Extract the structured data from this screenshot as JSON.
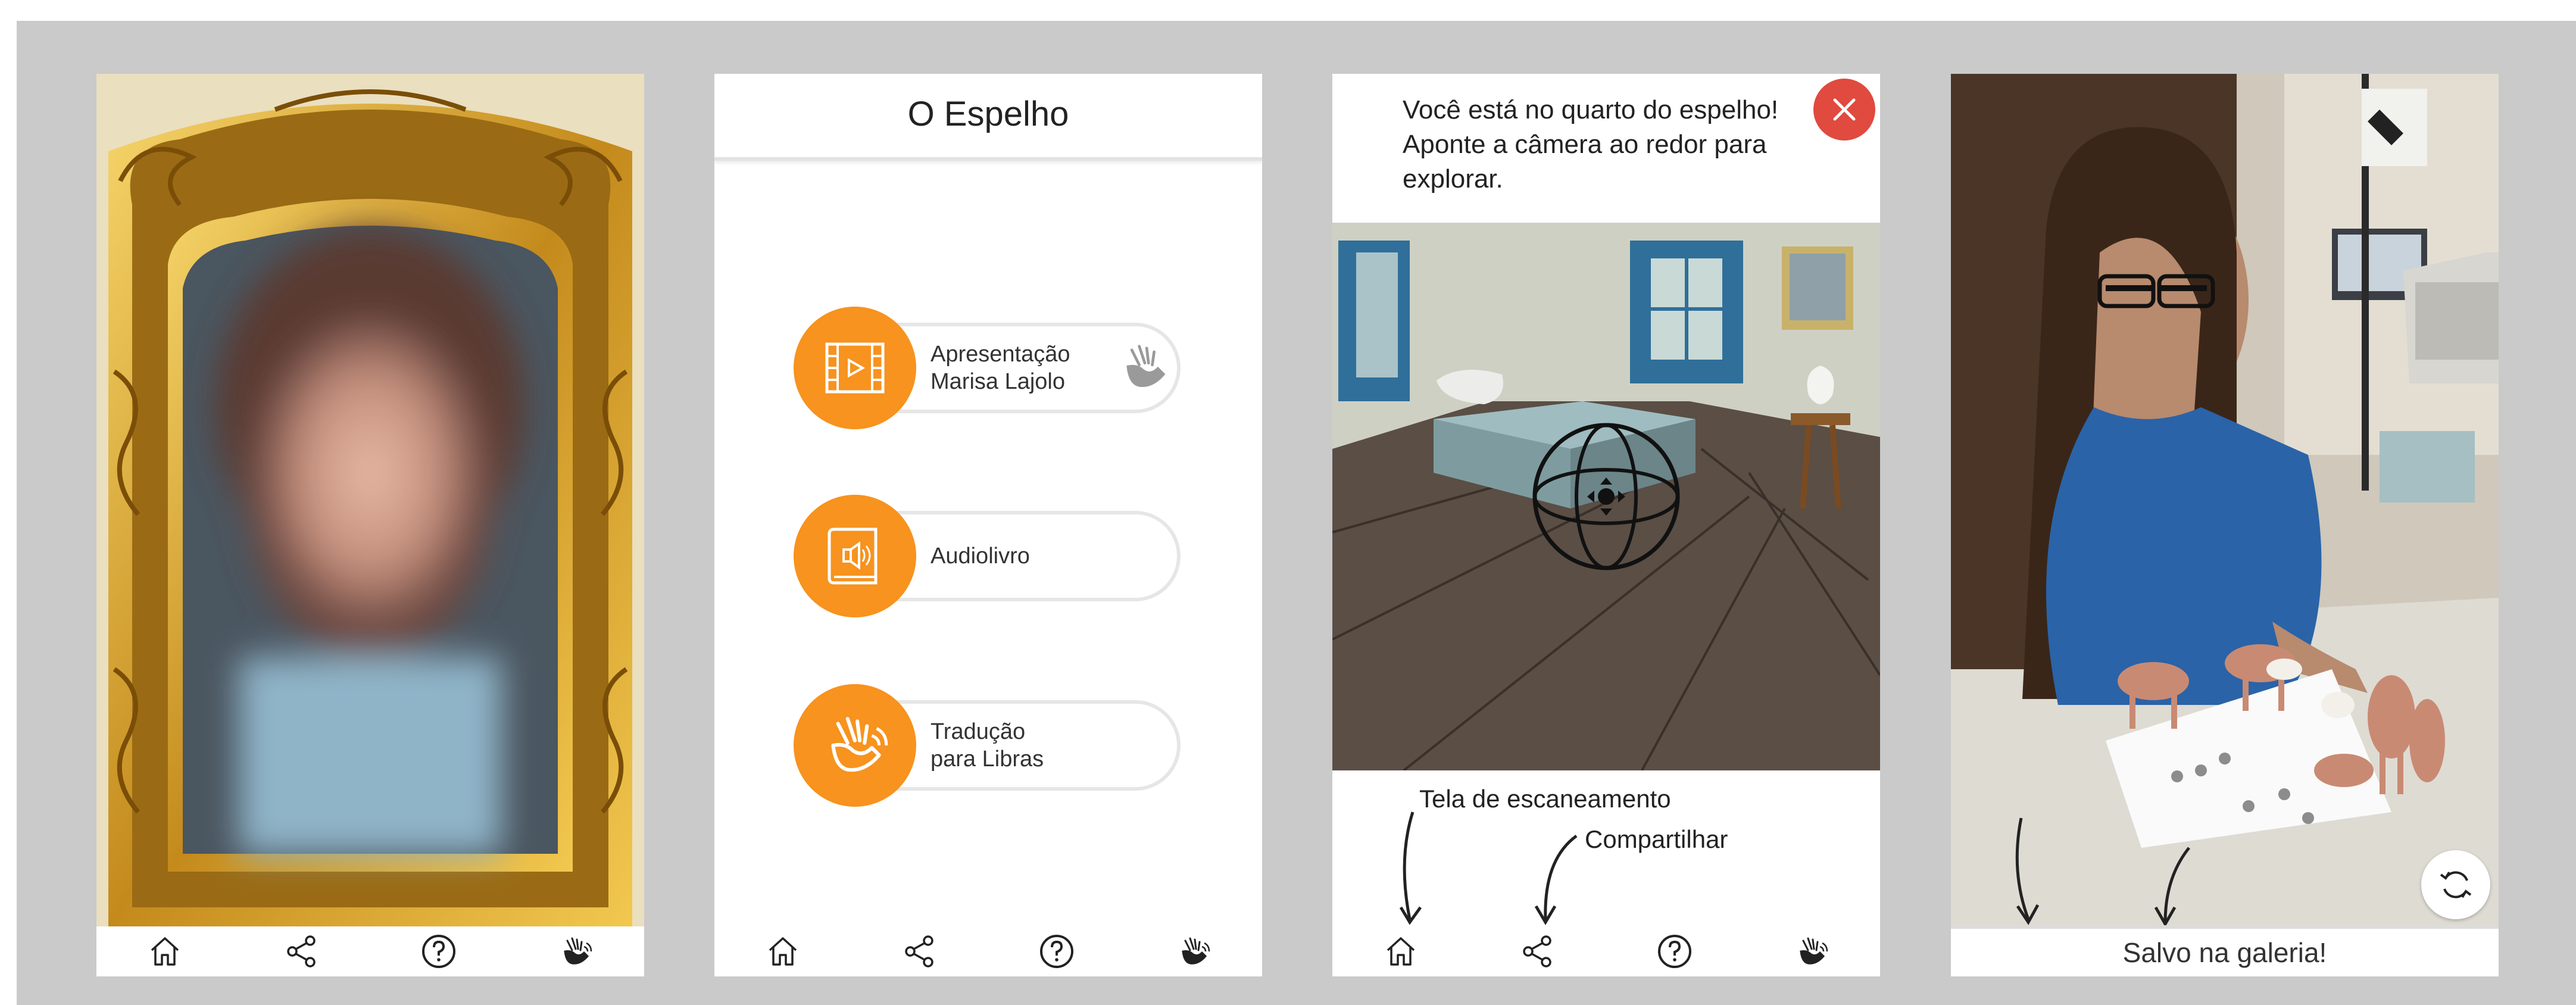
{
  "screen2": {
    "title": "O Espelho",
    "menu": [
      {
        "line1": "Apresentação",
        "line2": "Marisa Lajolo"
      },
      {
        "line1": "Audiolivro",
        "line2": ""
      },
      {
        "line1": "Tradução",
        "line2": "para Libras"
      }
    ]
  },
  "screen3": {
    "message_line1": "Você está no quarto do espelho!",
    "message_line2": "Aponte a câmera ao redor para",
    "message_line3": "explorar.",
    "annotation_scan": "Tela de escaneamento",
    "annotation_share": "Compartilhar"
  },
  "screen4": {
    "saved_label": "Salvo na galeria!"
  },
  "nav_icons": [
    "home-icon",
    "share-icon",
    "help-icon",
    "sign-language-icon"
  ],
  "colors": {
    "accent": "#f7931e",
    "close": "#e04a3f",
    "background": "#cacaca"
  }
}
